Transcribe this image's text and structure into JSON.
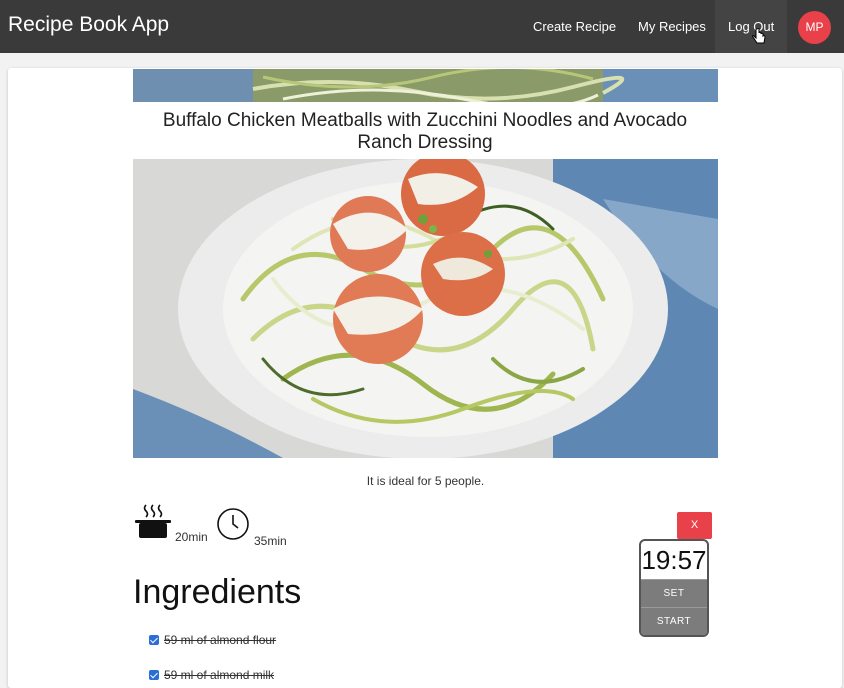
{
  "app": {
    "title": "Recipe Book App"
  },
  "nav": {
    "create_recipe": "Create Recipe",
    "my_recipes": "My Recipes",
    "log_out": "Log Out",
    "avatar_initials": "MP"
  },
  "recipe": {
    "title": "Buffalo Chicken Meatballs with Zucchini Noodles and Avocado Ranch Dressing",
    "servings_text": "It is ideal for 5 people.",
    "prep_time": "20min",
    "cook_time": "35min"
  },
  "ingredients": {
    "heading": "Ingredients",
    "items": [
      {
        "text": "59 ml of almond flour",
        "checked": true
      },
      {
        "text": "59 ml of almond milk",
        "checked": true
      }
    ]
  },
  "timer": {
    "close_label": "X",
    "display": "19:57",
    "set_label": "SET",
    "start_label": "START"
  },
  "colors": {
    "navbar": "#3a3a3a",
    "accent_red": "#e8414a",
    "checkbox_blue": "#2b6fd6"
  }
}
